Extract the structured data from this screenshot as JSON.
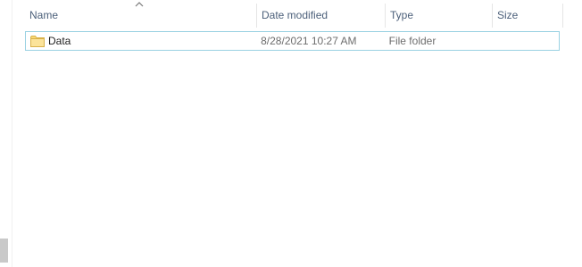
{
  "columns": {
    "name": "Name",
    "date_modified": "Date modified",
    "type": "Type",
    "size": "Size"
  },
  "sort": {
    "column": "name",
    "direction": "ascending"
  },
  "rows": [
    {
      "icon": "folder-icon",
      "name": "Data",
      "date_modified": "8/28/2021 10:27 AM",
      "type": "File folder",
      "size": ""
    }
  ],
  "colors": {
    "header_text": "#4c607a",
    "secondary_text": "#6d6d6d",
    "selection_border": "#99d1e2",
    "folder_fill": "#f8d775"
  }
}
